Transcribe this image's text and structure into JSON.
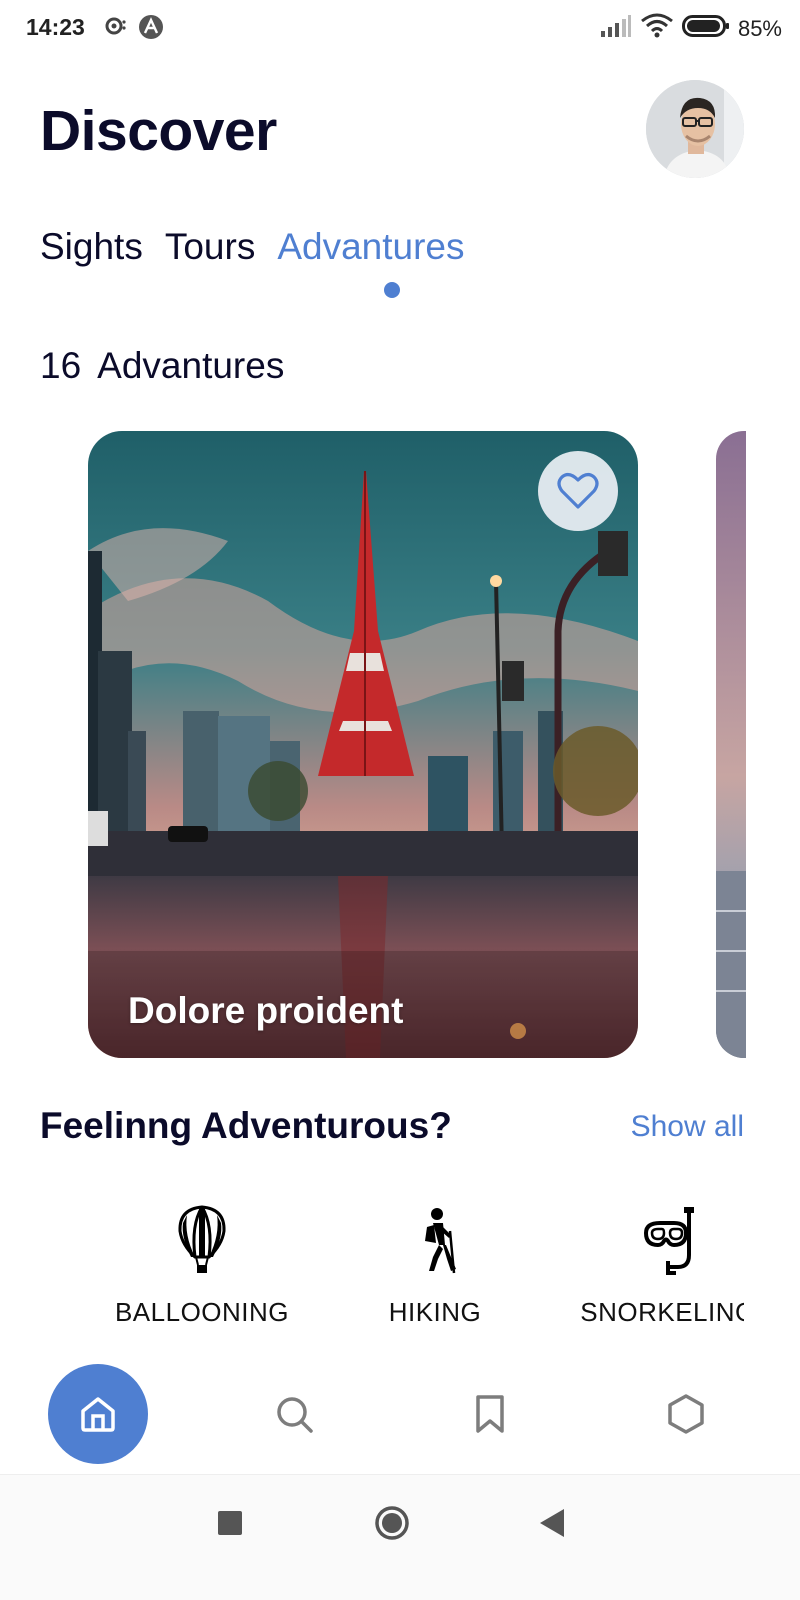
{
  "status_bar": {
    "time": "14:23",
    "battery": "85%"
  },
  "header": {
    "title": "Discover"
  },
  "tabs": [
    {
      "label": "Sights",
      "active": false
    },
    {
      "label": "Tours",
      "active": false
    },
    {
      "label": "Advantures",
      "active": true
    }
  ],
  "results": {
    "count": "16",
    "label": "Advantures"
  },
  "featured_card": {
    "title": "Dolore proident",
    "favorite_icon": "heart-outline-icon"
  },
  "section": {
    "title": "Feelinng Adventurous?",
    "show_all": "Show all"
  },
  "categories": [
    {
      "label": "BALLOONING",
      "icon": "hot-air-balloon-icon"
    },
    {
      "label": "HIKING",
      "icon": "hiker-icon"
    },
    {
      "label": "SNORKELING",
      "icon": "snorkel-mask-icon"
    }
  ],
  "bottom_nav": [
    {
      "icon": "home-icon",
      "active": true
    },
    {
      "icon": "search-icon",
      "active": false
    },
    {
      "icon": "bookmark-icon",
      "active": false
    },
    {
      "icon": "hexagon-icon",
      "active": false
    }
  ],
  "colors": {
    "accent": "#4f7fd1",
    "text_dark": "#0b0b2a"
  }
}
